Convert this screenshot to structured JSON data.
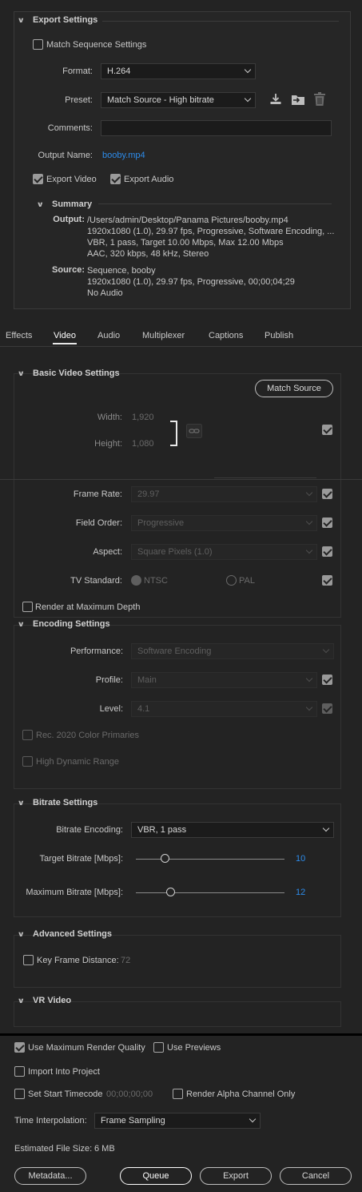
{
  "export_settings": {
    "header": "Export Settings",
    "match_sequence": "Match Sequence Settings",
    "format_label": "Format:",
    "format_value": "H.264",
    "preset_label": "Preset:",
    "preset_value": "Match Source - High bitrate",
    "comments_label": "Comments:",
    "comments_value": "",
    "output_name_label": "Output Name:",
    "output_name_value": "booby.mp4",
    "export_video": "Export Video",
    "export_audio": "Export Audio",
    "summary": {
      "header": "Summary",
      "output_label": "Output:",
      "output_lines": [
        "/Users/admin/Desktop/Panama Pictures/booby.mp4",
        "1920x1080 (1.0), 29.97 fps, Progressive, Software Encoding, ...",
        "VBR, 1 pass, Target 10.00 Mbps, Max 12.00 Mbps",
        "AAC, 320 kbps, 48 kHz, Stereo"
      ],
      "source_label": "Source:",
      "source_lines": [
        "Sequence, booby",
        "1920x1080 (1.0), 29.97 fps, Progressive, 00;00;04;29",
        "No Audio"
      ]
    }
  },
  "tabs": [
    "Effects",
    "Video",
    "Audio",
    "Multiplexer",
    "Captions",
    "Publish"
  ],
  "active_tab": "Video",
  "basic_video": {
    "header": "Basic Video Settings",
    "match_source": "Match Source",
    "width_label": "Width:",
    "width_value": "1,920",
    "height_label": "Height:",
    "height_value": "1,080",
    "frame_rate_label": "Frame Rate:",
    "frame_rate_value": "29.97",
    "field_order_label": "Field Order:",
    "field_order_value": "Progressive",
    "aspect_label": "Aspect:",
    "aspect_value": "Square Pixels (1.0)",
    "tv_standard_label": "TV Standard:",
    "ntsc": "NTSC",
    "pal": "PAL",
    "render_max_depth": "Render at Maximum Depth"
  },
  "encoding": {
    "header": "Encoding Settings",
    "performance_label": "Performance:",
    "performance_value": "Software Encoding",
    "profile_label": "Profile:",
    "profile_value": "Main",
    "level_label": "Level:",
    "level_value": "4.1",
    "rec2020": "Rec. 2020 Color Primaries",
    "hdr": "High Dynamic Range"
  },
  "bitrate": {
    "header": "Bitrate Settings",
    "encoding_label": "Bitrate Encoding:",
    "encoding_value": "VBR, 1 pass",
    "target_label": "Target Bitrate [Mbps]:",
    "target_value": "10",
    "max_label": "Maximum Bitrate [Mbps]:",
    "max_value": "12"
  },
  "advanced": {
    "header": "Advanced Settings",
    "key_frame_label": "Key Frame Distance:",
    "key_frame_value": "72"
  },
  "vr": {
    "header": "VR Video"
  },
  "footer": {
    "use_max_render": "Use Maximum Render Quality",
    "use_previews": "Use Previews",
    "import_into_project": "Import Into Project",
    "set_start_timecode": "Set Start Timecode",
    "timecode_value": "00;00;00;00",
    "render_alpha": "Render Alpha Channel Only",
    "time_interp_label": "Time Interpolation:",
    "time_interp_value": "Frame Sampling",
    "est_size_label": "Estimated File Size:",
    "est_size_value": "6 MB",
    "metadata": "Metadata...",
    "queue": "Queue",
    "export": "Export",
    "cancel": "Cancel"
  },
  "colors": {
    "accent_blue": "#2d8ceb",
    "background": "#232323"
  },
  "icons": [
    "save-preset-icon",
    "import-preset-icon",
    "delete-preset-icon",
    "link-icon",
    "chevron-down-icon"
  ]
}
